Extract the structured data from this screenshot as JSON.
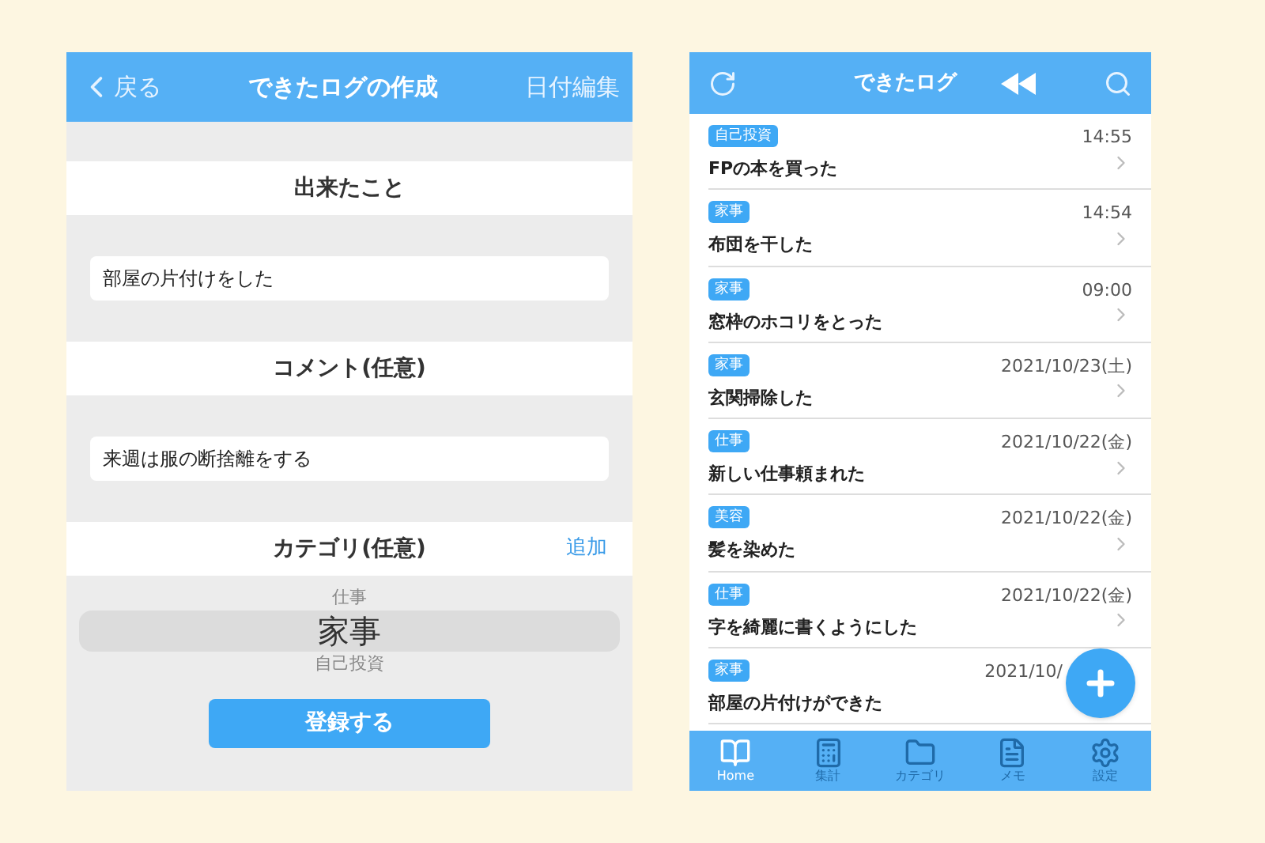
{
  "create_screen": {
    "header": {
      "back": "戻る",
      "title": "できたログの作成",
      "action": "日付編集"
    },
    "sections": [
      {
        "kind": "field",
        "title": "出来たこと",
        "value": "部屋の片付けをした"
      },
      {
        "kind": "field",
        "title": "コメント(任意)",
        "value": "来週は服の断捨離をする"
      },
      {
        "kind": "picker",
        "title": "カテゴリ(任意)",
        "action": "追加",
        "options": [
          {
            "label": "仕事",
            "selected": false
          },
          {
            "label": "家事",
            "selected": true
          },
          {
            "label": "自己投資",
            "selected": false
          }
        ]
      }
    ],
    "submit": "登録する"
  },
  "log_screen": {
    "header": {
      "title": "できたログ"
    },
    "rows": [
      {
        "tag": "自己投資",
        "time": "14:55",
        "text": "FPの本を買った"
      },
      {
        "tag": "家事",
        "time": "14:54",
        "text": "布団を干した"
      },
      {
        "tag": "家事",
        "time": "09:00",
        "text": "窓枠のホコリをとった"
      },
      {
        "tag": "家事",
        "time": "2021/10/23(土)",
        "text": "玄関掃除した"
      },
      {
        "tag": "仕事",
        "time": "2021/10/22(金)",
        "text": "新しい仕事頼まれた"
      },
      {
        "tag": "美容",
        "time": "2021/10/22(金)",
        "text": "髪を染めた"
      },
      {
        "tag": "仕事",
        "time": "2021/10/22(金)",
        "text": "字を綺麗に書くようにした"
      },
      {
        "tag": "家事",
        "time": "2021/10/",
        "text": "部屋の片付けができた"
      }
    ],
    "tabs": [
      {
        "kind": "book",
        "label": "Home",
        "selected": true
      },
      {
        "kind": "calc",
        "label": "集計",
        "selected": false
      },
      {
        "kind": "folder",
        "label": "カテゴリ",
        "selected": false
      },
      {
        "kind": "memo",
        "label": "メモ",
        "selected": false
      },
      {
        "kind": "gear",
        "label": "設定",
        "selected": false
      }
    ]
  }
}
